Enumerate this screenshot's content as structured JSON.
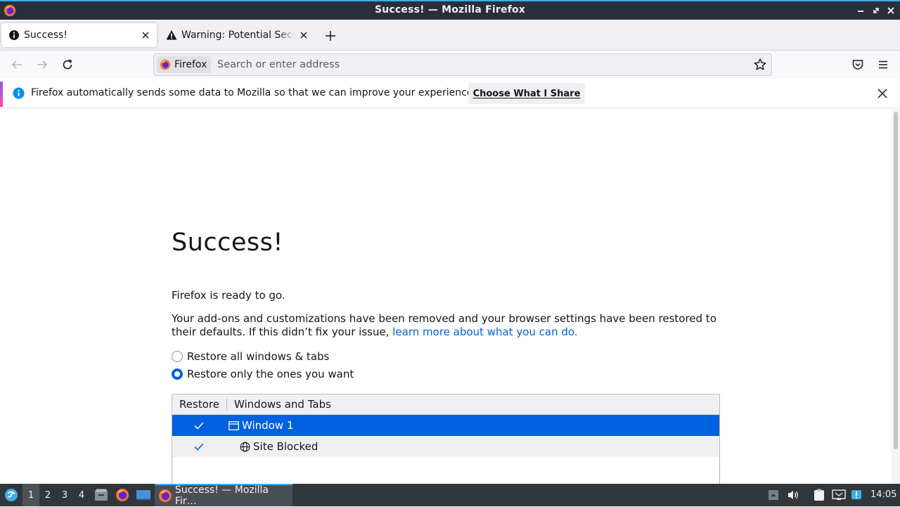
{
  "window": {
    "title": "Success! — Mozilla Firefox"
  },
  "tabs": [
    {
      "label": "Success!",
      "icon": "info-icon",
      "active": true
    },
    {
      "label": "Warning: Potential Security Risk Ahead",
      "icon": "warning-icon",
      "active": false
    }
  ],
  "urlbar": {
    "identity_label": "Firefox",
    "placeholder": "Search or enter address",
    "value": ""
  },
  "notification": {
    "text": "Firefox automatically sends some data to Mozilla so that we can improve your experience.",
    "button_label": "Choose What I Share"
  },
  "page": {
    "title": "Success!",
    "ready_text": "Firefox is ready to go.",
    "paragraph_text": "Your add-ons and customizations have been removed and your browser settings have been restored to their defaults. If this didn’t fix your issue, ",
    "paragraph_link": "learn more about what you can do.",
    "restore_options": [
      {
        "label": "Restore all windows & tabs",
        "checked": false
      },
      {
        "label": "Restore only the ones you want",
        "checked": true
      }
    ],
    "tree": {
      "columns": [
        "Restore",
        "Windows and Tabs"
      ],
      "rows": [
        {
          "label": "Window 1",
          "checked": true,
          "icon": "window-icon",
          "selected": true
        },
        {
          "label": "Site Blocked",
          "checked": true,
          "icon": "globe-icon",
          "selected": false
        }
      ]
    }
  },
  "taskbar": {
    "desktops": [
      "1",
      "2",
      "3",
      "4"
    ],
    "active_task": "Success! — Mozilla Fir…",
    "clock": "14:05",
    "accent": "#3daee9"
  },
  "colors": {
    "link": "#0061e0",
    "selection": "#0061e0",
    "titlebar": "#2b2e3b",
    "taskbar": "#31363b"
  }
}
